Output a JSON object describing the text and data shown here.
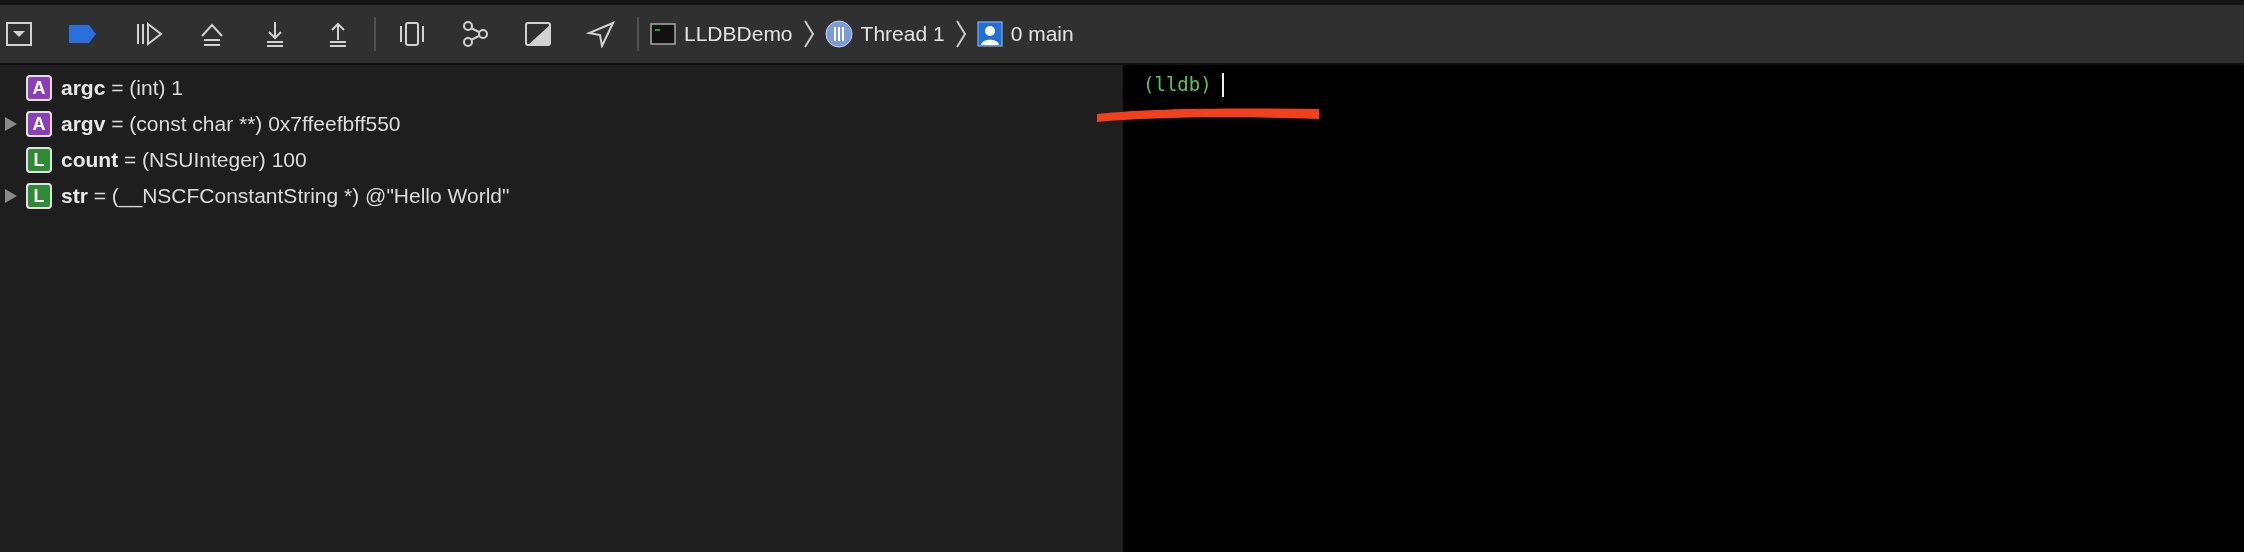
{
  "breadcrumb": [
    {
      "kind": "app",
      "label": "LLDBDemo"
    },
    {
      "kind": "thread",
      "label": "Thread 1"
    },
    {
      "kind": "frame",
      "label": "0 main"
    }
  ],
  "variables": [
    {
      "kind": "argument",
      "badge": "A",
      "name": "argc",
      "value": "= (int) 1",
      "expandable": false
    },
    {
      "kind": "argument",
      "badge": "A",
      "name": "argv",
      "value": "= (const char **) 0x7ffeefbff550",
      "expandable": true
    },
    {
      "kind": "local",
      "badge": "L",
      "name": "count",
      "value": "= (NSUInteger) 100",
      "expandable": false
    },
    {
      "kind": "local",
      "badge": "L",
      "name": "str",
      "value": "= (__NSCFConstantString *) @\"Hello World\"",
      "expandable": true
    }
  ],
  "console": {
    "prompt": "(lldb)"
  }
}
